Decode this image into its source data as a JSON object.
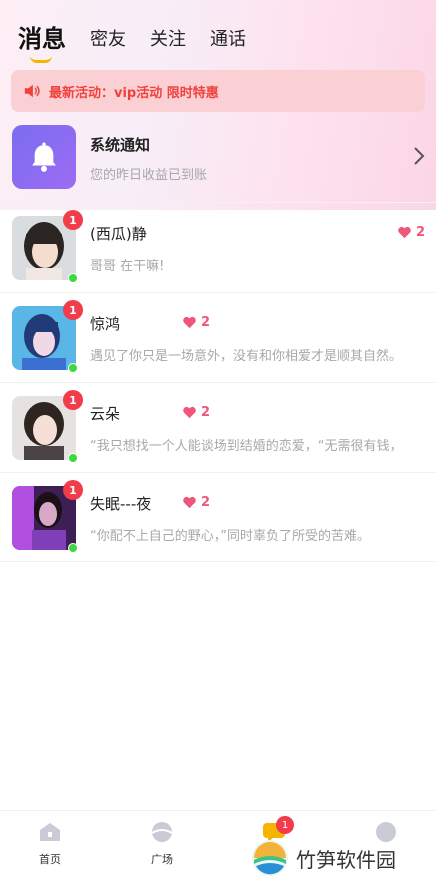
{
  "tabs": [
    "消息",
    "密友",
    "关注",
    "通话"
  ],
  "banner": {
    "text": "最新活动：vip活动 限时特惠"
  },
  "system_notice": {
    "title": "系统通知",
    "subtitle": "您的昨日收益已到账"
  },
  "messages": [
    {
      "name": "(西瓜)静",
      "preview": "哥哥 在干嘛!",
      "unread": "1",
      "hearts": "2"
    },
    {
      "name": "惊鸿",
      "preview": "遇见了你只是一场意外，没有和你相爱才是顺其自然。",
      "unread": "1",
      "hearts": "2"
    },
    {
      "name": "云朵",
      "preview": "“我只想找一个人能谈场到结婚的恋爱，“无需很有钱，",
      "unread": "1",
      "hearts": "2"
    },
    {
      "name": "失眠---夜",
      "preview": "“你配不上自己的野心，”同时辜负了所受的苦难。",
      "unread": "1",
      "hearts": "2"
    }
  ],
  "bottom_nav": [
    {
      "label": "首页"
    },
    {
      "label": "广场"
    },
    {
      "label": "",
      "badge": "1"
    },
    {
      "label": ""
    }
  ],
  "watermark": "竹笋软件园",
  "colors": {
    "accent": "#f5b400",
    "banner_bg": "#fbd0d4",
    "banner_text": "#f1413c",
    "badge": "#f23b4b",
    "online": "#3ed93e",
    "heart": "#f0567a"
  }
}
